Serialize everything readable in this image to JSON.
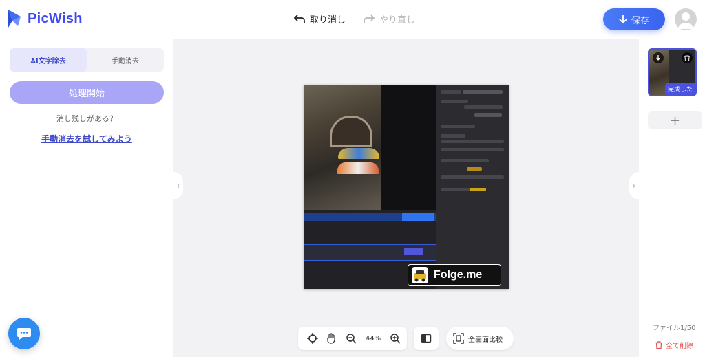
{
  "header": {
    "brand": "PicWish",
    "undo_label": "取り消し",
    "redo_label": "やり直し",
    "save_label": "保存"
  },
  "left_panel": {
    "tabs": [
      {
        "label": "AI文字除去",
        "active": true
      },
      {
        "label": "手動消去",
        "active": false
      }
    ],
    "process_label": "処理開始",
    "remain_text": "消し残しがある？",
    "manual_link": "手動消去を試してみよう"
  },
  "canvas": {
    "watermark_text": "Folge.me",
    "zoom_level": "44%",
    "full_compare_label": "全画面比較"
  },
  "right_panel": {
    "thumbnail_status": "完成した",
    "file_count": "ファイル1/50",
    "delete_all_label": "全て削除"
  },
  "colors": {
    "brand": "#3f49f0",
    "process_button": "#a9a6f7",
    "save_button": "#3b63f0",
    "delete": "#e05050"
  }
}
